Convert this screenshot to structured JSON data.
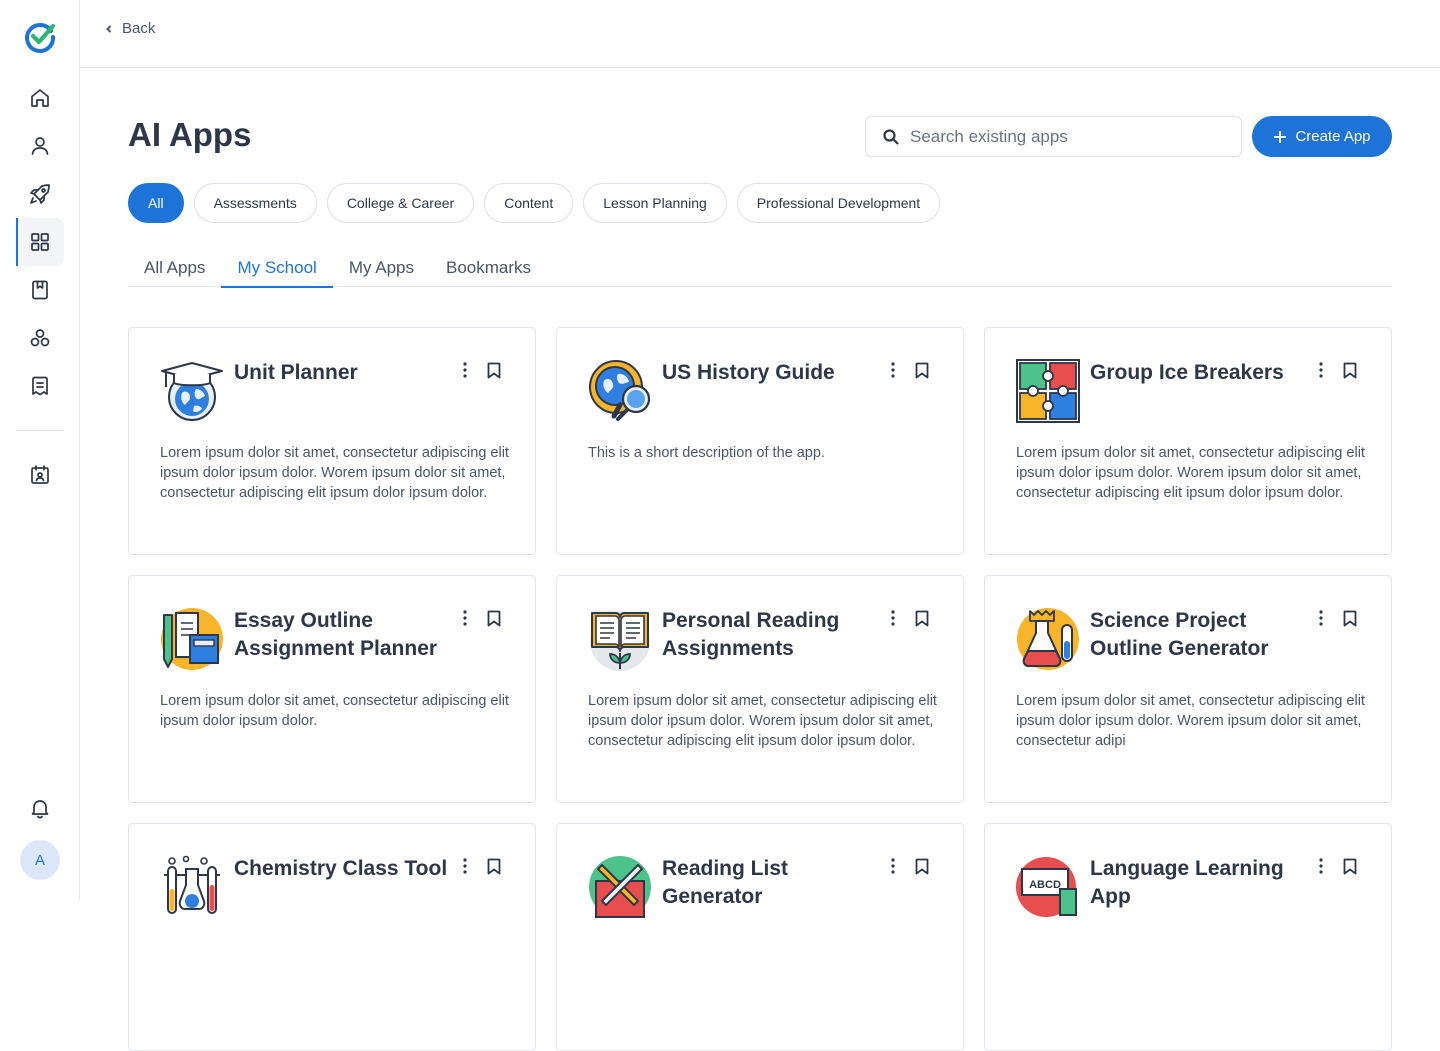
{
  "topbar": {
    "back_label": "Back"
  },
  "page": {
    "title": "AI Apps"
  },
  "search": {
    "placeholder": "Search existing apps"
  },
  "create_button": {
    "label": "Create App"
  },
  "filters": [
    "All",
    "Assessments",
    "College & Career",
    "Content",
    "Lesson Planning",
    "Professional Development"
  ],
  "filters_active": "All",
  "tabs": [
    "All Apps",
    "My School",
    "My Apps",
    "Bookmarks"
  ],
  "tabs_active": "My School",
  "avatar": {
    "initial": "A"
  },
  "sidebar": {
    "icons": [
      "home-icon",
      "user-icon",
      "rocket-icon",
      "apps-grid-icon",
      "bookmark-book-icon",
      "community-icon",
      "library-icon",
      "calendar-contact-icon",
      "bell-icon"
    ],
    "active": "apps-grid-icon"
  },
  "colors": {
    "accent": "#1e73d8",
    "text": "#2d3748",
    "muted": "#4a5568",
    "border": "#e2e5ea"
  },
  "cards": [
    {
      "title": "Unit Planner",
      "icon": "graduation-globe-icon",
      "description": "Lorem ipsum dolor sit amet, consectetur adipiscing elit ipsum dolor ipsum dolor. Worem ipsum dolor sit amet, consectetur adipiscing elit ipsum dolor ipsum dolor."
    },
    {
      "title": "US History Guide",
      "icon": "globe-magnifier-icon",
      "description": "This is a short description of the app."
    },
    {
      "title": "Group Ice Breakers",
      "icon": "puzzle-icon",
      "description": "Lorem ipsum dolor sit amet, consectetur adipiscing elit ipsum dolor ipsum dolor. Worem ipsum dolor sit amet, consectetur adipiscing elit ipsum dolor ipsum dolor."
    },
    {
      "title": "Essay Outline Assignment Planner",
      "icon": "books-pencil-icon",
      "description": "Lorem ipsum dolor sit amet, consectetur adipiscing elit ipsum dolor ipsum dolor."
    },
    {
      "title": "Personal Reading Assignments",
      "icon": "open-book-plant-icon",
      "description": "Lorem ipsum dolor sit amet, consectetur adipiscing elit ipsum dolor ipsum dolor. Worem ipsum dolor sit amet, consectetur adipiscing elit ipsum dolor ipsum dolor."
    },
    {
      "title": "Science Project Outline Generator",
      "icon": "flask-icon",
      "description": "Lorem ipsum dolor sit amet, consectetur adipiscing elit ipsum dolor ipsum dolor. Worem ipsum dolor sit amet, consectetur adipi"
    },
    {
      "title": "Chemistry Class Tool",
      "icon": "chemistry-tubes-icon",
      "description": ""
    },
    {
      "title": "Reading List Generator",
      "icon": "book-pencil-ruler-icon",
      "description": ""
    },
    {
      "title": "Language Learning App",
      "icon": "abcd-board-icon",
      "description": ""
    }
  ]
}
